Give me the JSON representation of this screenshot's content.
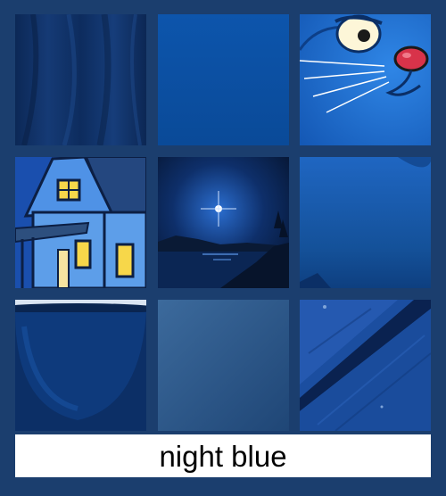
{
  "palette_name": "night blue",
  "swatches": [
    {
      "label": "",
      "color": "#0f2f63",
      "icon": "fabric-drape"
    },
    {
      "label": "",
      "color": "#0b4ea0",
      "icon": "solid-blue"
    },
    {
      "label": "",
      "color": "#1f6fd2",
      "icon": "cartoon-cat-face"
    },
    {
      "label": "",
      "color": "#2a6bd0",
      "icon": "cartoon-house-night"
    },
    {
      "label": "",
      "color": "#0a1f45",
      "icon": "moonlit-lake"
    },
    {
      "label": "",
      "color": "#1559a8",
      "icon": "dusk-sky"
    },
    {
      "label": "",
      "color": "#0e3472",
      "icon": "ceramic-bowl"
    },
    {
      "label": "",
      "color": "#2d5686",
      "icon": "matte-gradient"
    },
    {
      "label": "",
      "color": "#1a4fa0",
      "icon": "wood-planks"
    }
  ]
}
